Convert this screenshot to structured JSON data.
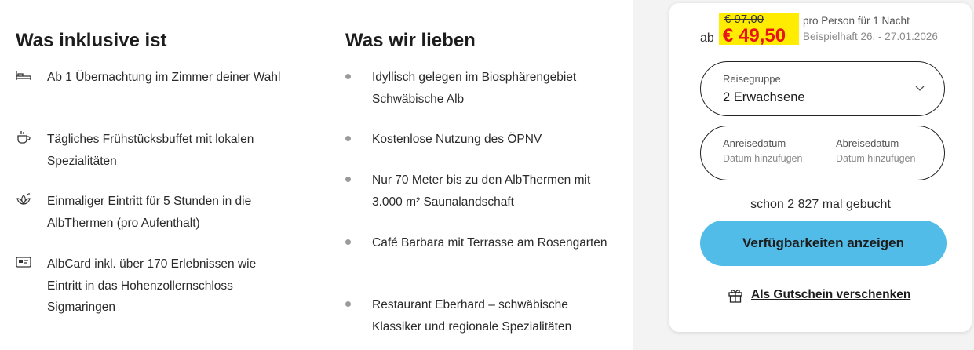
{
  "inclusive": {
    "title": "Was inklusive ist",
    "items": [
      {
        "icon": "bed-icon",
        "text": "Ab 1 Übernachtung im Zimmer deiner Wahl"
      },
      {
        "icon": "coffee-cup-icon",
        "text": "Tägliches Frühstücksbuffet mit lokalen Spezialitäten"
      },
      {
        "icon": "spa-lotus-icon",
        "text": "Einmaliger Eintritt für 5 Stunden in die AlbThermen (pro Aufenthalt)"
      },
      {
        "icon": "card-icon",
        "text": "AlbCard inkl. über 170 Erlebnissen wie Eintritt in das Hohenzollernschloss Sigmaringen"
      }
    ]
  },
  "love": {
    "title": "Was wir lieben",
    "items": [
      {
        "text": "Idyllisch gelegen im Biosphärengebiet Schwäbische Alb"
      },
      {
        "text": "Kostenlose Nutzung des ÖPNV"
      },
      {
        "text": "Nur 70 Meter bis zu den AlbThermen mit 3.000 m² Saunalandschaft"
      },
      {
        "text": "Café Barbara mit Terrasse am Rosengarten"
      },
      {
        "text": "Restaurant Eberhard – schwäbische Klassiker und regionale Spezialitäten"
      }
    ]
  },
  "booking": {
    "old_price": "€ 97,00",
    "prefix": "ab",
    "price": "€ 49,50",
    "per_person": "pro Person für 1 Nacht",
    "example": "Beispielhaft 26. - 27.01.2026",
    "group": {
      "label": "Reisegruppe",
      "value": "2 Erwachsene"
    },
    "arrival": {
      "label": "Anreisedatum",
      "placeholder": "Datum hinzufügen"
    },
    "departure": {
      "label": "Abreisedatum",
      "placeholder": "Datum hinzufügen"
    },
    "booked_count": "schon 2 827 mal gebucht",
    "cta_label": "Verfügbarkeiten anzeigen",
    "gift_label": "Als Gutschein verschenken"
  },
  "colors": {
    "cta": "#52bce8",
    "price_red": "#e8141c",
    "highlight": "#ffec00"
  }
}
